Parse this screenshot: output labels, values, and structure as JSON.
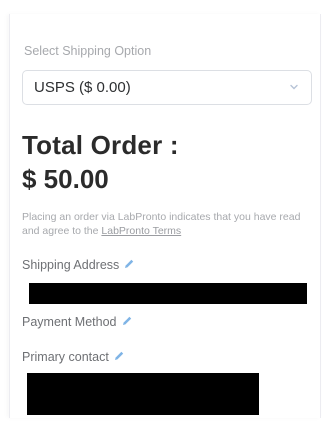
{
  "shipping": {
    "label": "Select Shipping Option",
    "selected": "USPS ($ 0.00)"
  },
  "order": {
    "total_label": "Total Order :",
    "total_value": "$ 50.00"
  },
  "terms": {
    "text": "Placing an order via LabPronto indicates that you have read and agree to the ",
    "link_text": "LabPronto Terms"
  },
  "fields": {
    "shipping_address_label": "Shipping Address",
    "payment_method_label": "Payment Method",
    "primary_contact_label": "Primary contact"
  },
  "icons": {
    "edit": "pencil-icon",
    "dropdown": "chevron-down-icon"
  },
  "colors": {
    "edit_icon": "#7fb4e6",
    "muted_text": "#a7a9ad",
    "heading": "#2b2b2b",
    "redaction": "#000000"
  }
}
